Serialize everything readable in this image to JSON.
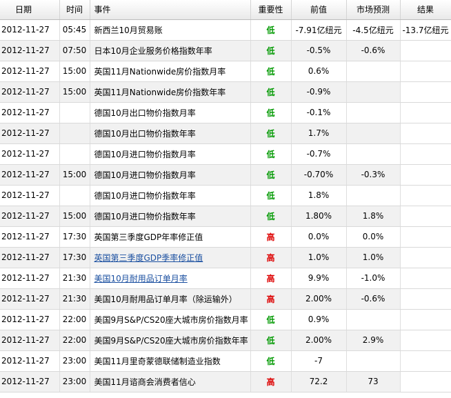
{
  "columns": {
    "date": "日期",
    "time": "时间",
    "event": "事件",
    "importance": "重要性",
    "previous": "前值",
    "forecast": "市场预测",
    "actual": "结果"
  },
  "colors": {
    "low_importance": "#009900",
    "high_importance": "#dd0000",
    "link": "#1a4fa0"
  },
  "rows": [
    {
      "date": "2012-11-27",
      "time": "05:45",
      "event": "新西兰10月贸易账",
      "importance": "低",
      "level": "low",
      "previous": "-7.91亿纽元",
      "forecast": "-4.5亿纽元",
      "actual": "-13.7亿纽元",
      "link": false
    },
    {
      "date": "2012-11-27",
      "time": "07:50",
      "event": "日本10月企业服务价格指数年率",
      "importance": "低",
      "level": "low",
      "previous": "-0.5%",
      "forecast": "-0.6%",
      "actual": "",
      "link": false
    },
    {
      "date": "2012-11-27",
      "time": "15:00",
      "event": "英国11月Nationwide房价指数月率",
      "importance": "低",
      "level": "low",
      "previous": "0.6%",
      "forecast": "",
      "actual": "",
      "link": false
    },
    {
      "date": "2012-11-27",
      "time": "15:00",
      "event": "英国11月Nationwide房价指数年率",
      "importance": "低",
      "level": "low",
      "previous": "-0.9%",
      "forecast": "",
      "actual": "",
      "link": false
    },
    {
      "date": "2012-11-27",
      "time": "",
      "event": "德国10月出口物价指数月率",
      "importance": "低",
      "level": "low",
      "previous": "-0.1%",
      "forecast": "",
      "actual": "",
      "link": false
    },
    {
      "date": "2012-11-27",
      "time": "",
      "event": "德国10月出口物价指数年率",
      "importance": "低",
      "level": "low",
      "previous": "1.7%",
      "forecast": "",
      "actual": "",
      "link": false
    },
    {
      "date": "2012-11-27",
      "time": "",
      "event": "德国10月进口物价指数月率",
      "importance": "低",
      "level": "low",
      "previous": "-0.7%",
      "forecast": "",
      "actual": "",
      "link": false
    },
    {
      "date": "2012-11-27",
      "time": "15:00",
      "event": "德国10月进口物价指数月率",
      "importance": "低",
      "level": "low",
      "previous": "-0.70%",
      "forecast": "-0.3%",
      "actual": "",
      "link": false
    },
    {
      "date": "2012-11-27",
      "time": "",
      "event": "德国10月进口物价指数年率",
      "importance": "低",
      "level": "low",
      "previous": "1.8%",
      "forecast": "",
      "actual": "",
      "link": false
    },
    {
      "date": "2012-11-27",
      "time": "15:00",
      "event": "德国10月进口物价指数年率",
      "importance": "低",
      "level": "low",
      "previous": "1.80%",
      "forecast": "1.8%",
      "actual": "",
      "link": false
    },
    {
      "date": "2012-11-27",
      "time": "17:30",
      "event": "英国第三季度GDP年率修正值",
      "importance": "高",
      "level": "high",
      "previous": "0.0%",
      "forecast": "0.0%",
      "actual": "",
      "link": false
    },
    {
      "date": "2012-11-27",
      "time": "17:30",
      "event": "英国第三季度GDP季率修正值",
      "importance": "高",
      "level": "high",
      "previous": "1.0%",
      "forecast": "1.0%",
      "actual": "",
      "link": true
    },
    {
      "date": "2012-11-27",
      "time": "21:30",
      "event": "美国10月耐用品订单月率",
      "importance": "高",
      "level": "high",
      "previous": "9.9%",
      "forecast": "-1.0%",
      "actual": "",
      "link": true
    },
    {
      "date": "2012-11-27",
      "time": "21:30",
      "event": "美国10月耐用品订单月率（除运输外）",
      "importance": "高",
      "level": "high",
      "previous": "2.00%",
      "forecast": "-0.6%",
      "actual": "",
      "link": false
    },
    {
      "date": "2012-11-27",
      "time": "22:00",
      "event": "美国9月S&P/CS20座大城市房价指数月率",
      "importance": "低",
      "level": "low",
      "previous": "0.9%",
      "forecast": "",
      "actual": "",
      "link": false
    },
    {
      "date": "2012-11-27",
      "time": "22:00",
      "event": "美国9月S&P/CS20座大城市房价指数年率",
      "importance": "低",
      "level": "low",
      "previous": "2.00%",
      "forecast": "2.9%",
      "actual": "",
      "link": false
    },
    {
      "date": "2012-11-27",
      "time": "23:00",
      "event": "美国11月里奇蒙德联储制造业指数",
      "importance": "低",
      "level": "low",
      "previous": "-7",
      "forecast": "",
      "actual": "",
      "link": false
    },
    {
      "date": "2012-11-27",
      "time": "23:00",
      "event": "美国11月谘商会消费者信心",
      "importance": "高",
      "level": "high",
      "previous": "72.2",
      "forecast": "73",
      "actual": "",
      "link": false
    }
  ]
}
